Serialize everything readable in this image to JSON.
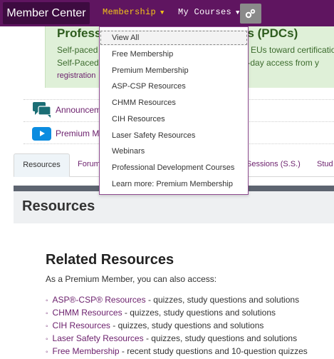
{
  "nav": {
    "brand": "Member Center",
    "membership": "Membership",
    "my_courses": "My Courses",
    "settings_icon": "gears-icon",
    "accent": "#f5c518",
    "bar_color": "#5f1560"
  },
  "dropdown": {
    "items": [
      "View All",
      "Free Membership",
      "Premium Membership",
      "ASP-CSP Resources",
      "CHMM Resources",
      "CIH Resources",
      "Laser Safety Resources",
      "Webinars",
      "Professional Development Courses",
      "Learn more: Premium Membership"
    ]
  },
  "banner": {
    "title_left": "Profess",
    "title_right": "es (PDCs)",
    "line1_left": "Self-paced",
    "line1_right": "EUs toward certification",
    "line2_left": "Self-Paced",
    "line2_right": "t. 60-day access from y",
    "line3": "registration"
  },
  "links": {
    "announcements": "Announcem",
    "premium": "Premium M"
  },
  "tabs": {
    "resources": "Resources",
    "forum": "Forum",
    "sessions": "Sessions (S.S.)",
    "study": "Stud"
  },
  "resources": {
    "heading": "Resources",
    "related_title": "Related Resources",
    "intro": "As a Premium Member, you can also access:",
    "items": [
      {
        "name": "ASP®-CSP® Resources",
        "desc": " - quizzes, study questions and solutions"
      },
      {
        "name": "CHMM Resources",
        "desc": " - quizzes, study questions and solutions"
      },
      {
        "name": "CIH Resources",
        "desc": " - quizzes, study questions and solutions"
      },
      {
        "name": "Laser Safety Resources",
        "desc": " - quizzes, study questions and solutions"
      },
      {
        "name": "Free Membership",
        "desc": " - recent study questions and 10-question quizzes"
      }
    ]
  }
}
